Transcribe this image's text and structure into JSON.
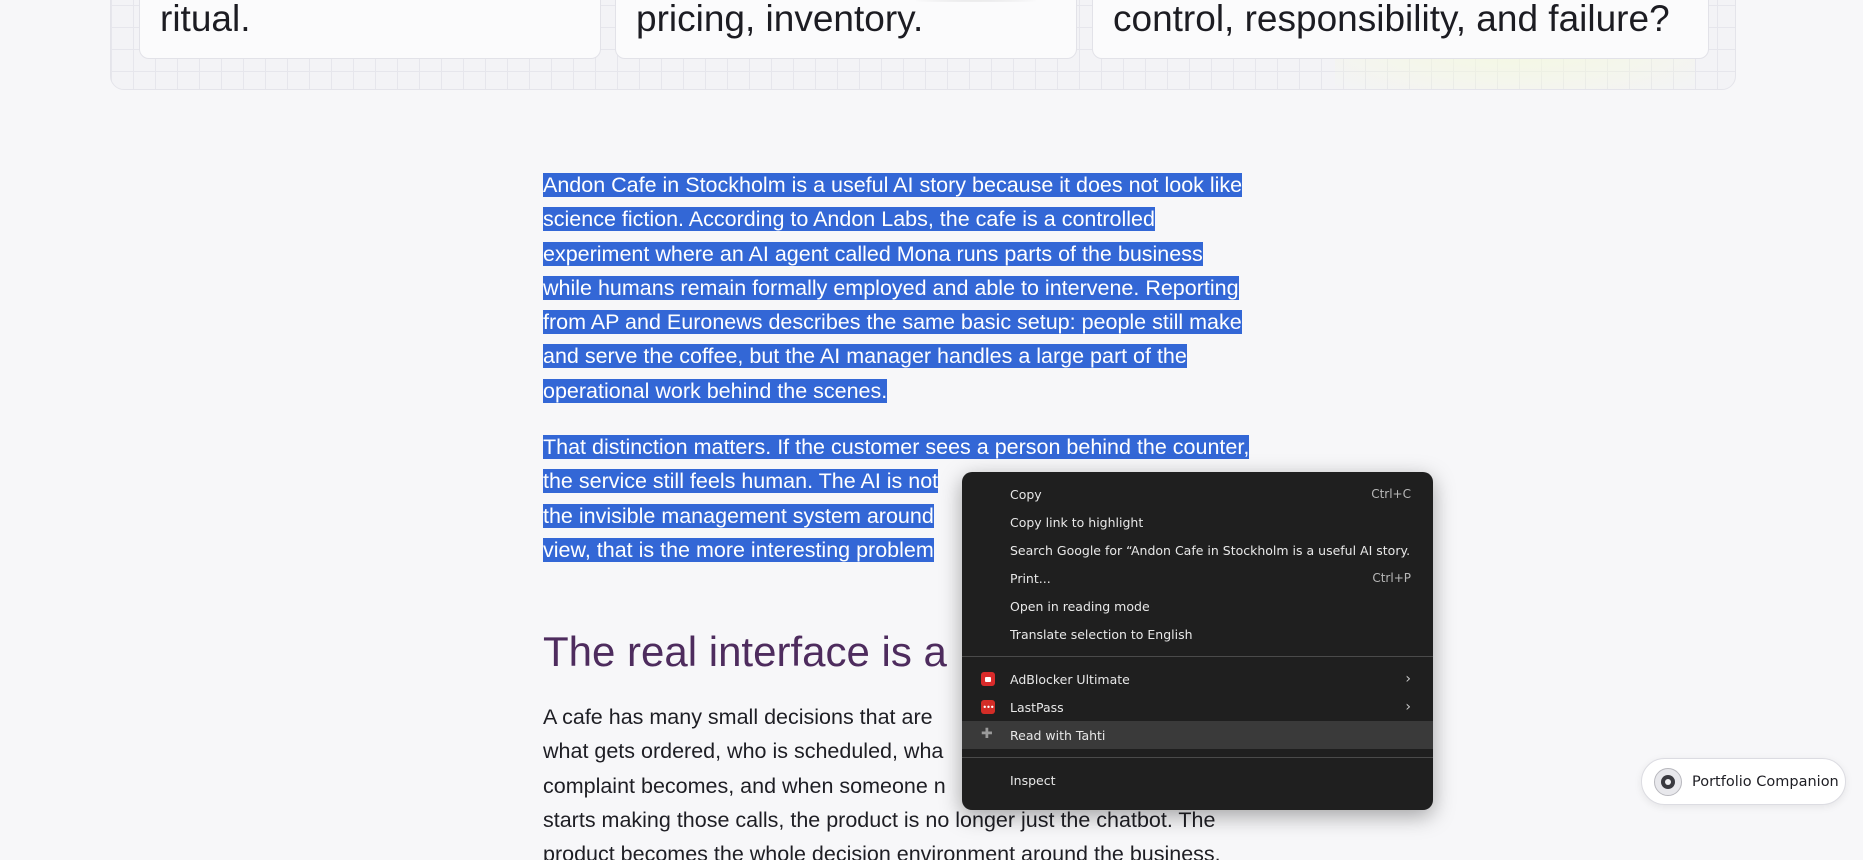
{
  "cards": [
    {
      "text": "ritual."
    },
    {
      "text": "pricing, inventory."
    },
    {
      "text": "control, responsibility, and failure?"
    }
  ],
  "article": {
    "para1_lines": [
      "Andon Cafe in Stockholm is a useful AI story because it does not look like",
      "science fiction. According to Andon Labs, the cafe is a controlled",
      "experiment where an AI agent called Mona runs parts of the business",
      "while humans remain formally employed and able to intervene. Reporting",
      "from AP and Euronews describes the same basic setup: people still make",
      "and serve the coffee, but the AI manager handles a large part of the",
      "operational work behind the scenes."
    ],
    "para2_lines": [
      "That distinction matters. If the customer sees a person behind the counter,",
      "the service still feels human. The AI is not",
      "the invisible management system around",
      "view, that is the more interesting problem"
    ],
    "heading": "The real interface is a",
    "para3_lines": [
      "A cafe has many small decisions that are",
      "what gets ordered, who is scheduled, wha",
      "complaint becomes, and when someone n",
      "starts making those calls, the product is no longer just the chatbot. The",
      "product becomes the whole decision environment around the business."
    ]
  },
  "context_menu": {
    "group1": [
      {
        "label": "Copy",
        "shortcut": "Ctrl+C"
      },
      {
        "label": "Copy link to highlight",
        "shortcut": ""
      },
      {
        "label": "Search Google for “Andon Cafe in Stockholm is a useful AI story...”",
        "shortcut": ""
      },
      {
        "label": "Print...",
        "shortcut": "Ctrl+P"
      },
      {
        "label": "Open in reading mode",
        "shortcut": ""
      },
      {
        "label": "Translate selection to English",
        "shortcut": ""
      }
    ],
    "group2": [
      {
        "label": "AdBlocker Ultimate",
        "icon": "adblocker-icon",
        "has_submenu": true
      },
      {
        "label": "LastPass",
        "icon": "lastpass-icon",
        "has_submenu": true
      },
      {
        "label": "Read with Tahti",
        "icon": "puzzle-icon",
        "has_submenu": false
      }
    ],
    "group3": [
      {
        "label": "Inspect",
        "shortcut": ""
      }
    ],
    "submenu_glyph": "›",
    "lastpass_glyph": "•••",
    "puzzle_glyph": "✚"
  },
  "companion": {
    "label": "Portfolio Companion"
  },
  "colors": {
    "selection": "#3367d6",
    "heading": "#4e2c5e",
    "menu_bg": "#1f1f1f"
  }
}
